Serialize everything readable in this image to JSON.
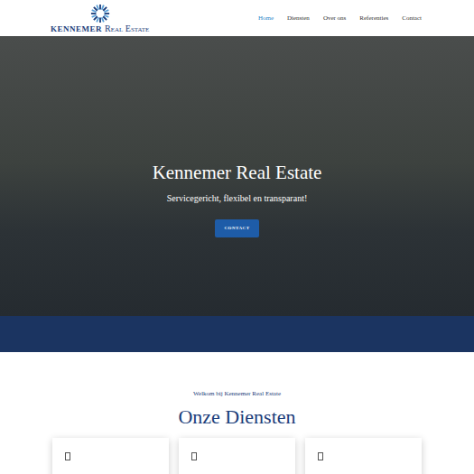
{
  "logo": {
    "brand": "KENNEMER",
    "sub": "Real Estate"
  },
  "nav": [
    {
      "label": "Home",
      "selected": true
    },
    {
      "label": "Diensten",
      "selected": false
    },
    {
      "label": "Over ons",
      "selected": false
    },
    {
      "label": "Referenties",
      "selected": false
    },
    {
      "label": "Contact",
      "selected": false
    }
  ],
  "hero": {
    "title": "Kennemer Real Estate",
    "subtitle": "Servicegericht, flexibel en transparant!",
    "button": "CONTACT"
  },
  "section": {
    "eyebrow": "Welkom bij Kennemer Real Estate",
    "heading": "Onze Diensten"
  },
  "cards": [
    {
      "kind": "service"
    },
    {
      "kind": "service"
    },
    {
      "kind": "service"
    }
  ]
}
